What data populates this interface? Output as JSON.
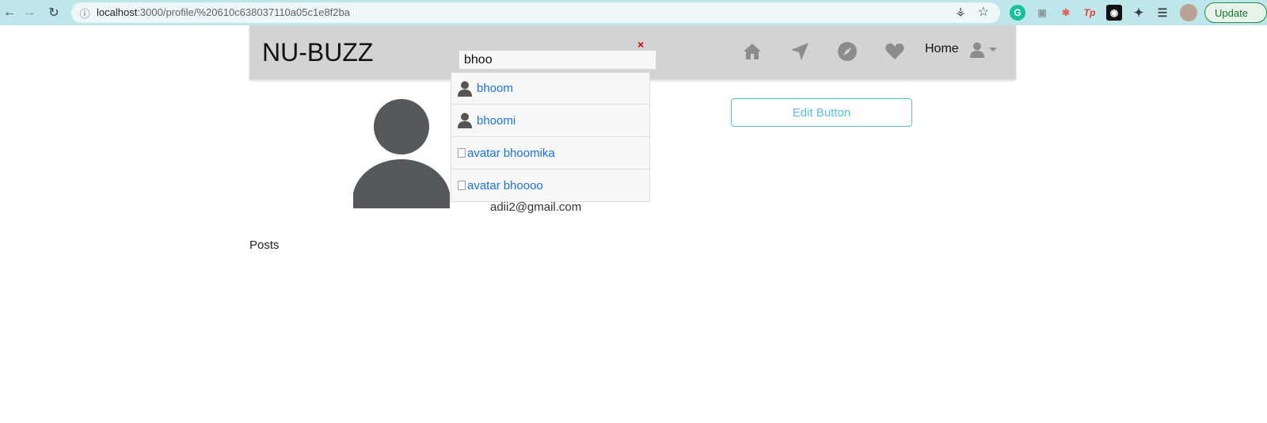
{
  "browser": {
    "url_host": "localhost",
    "url_rest": ":3000/profile/%20610c638037110a05c1e8f2ba",
    "update_label": "Update",
    "icons": [
      "back-icon",
      "forward-icon",
      "reload-icon",
      "info-icon",
      "key-icon",
      "star-icon",
      "grammarly-icon",
      "extension-icon",
      "tp-icon",
      "github-icon",
      "puzzle-icon",
      "media-icon",
      "profile-avatar-icon"
    ]
  },
  "navbar": {
    "brand": "NU-BUZZ",
    "search_value": "bhoo",
    "clear_symbol": "×",
    "home_label": "Home",
    "icons": [
      "home-icon",
      "send-icon",
      "explore-icon",
      "heart-icon",
      "user-icon",
      "caret-down-icon"
    ],
    "background": "#d3d3d3"
  },
  "search_results": [
    {
      "name": "bhoom",
      "avatar": "person-icon"
    },
    {
      "name": "bhoomi",
      "avatar": "person-icon"
    },
    {
      "name": "bhoomika",
      "avatar_alt": "avatar"
    },
    {
      "name": "bhoooo",
      "avatar_alt": "avatar"
    }
  ],
  "profile": {
    "email": "adii2@gmail.com",
    "edit_label": "Edit Button",
    "posts_label": "Posts"
  },
  "colors": {
    "link": "#1a73e8",
    "edit_button": "#5bc0de",
    "clear_x": "#d0021b"
  }
}
